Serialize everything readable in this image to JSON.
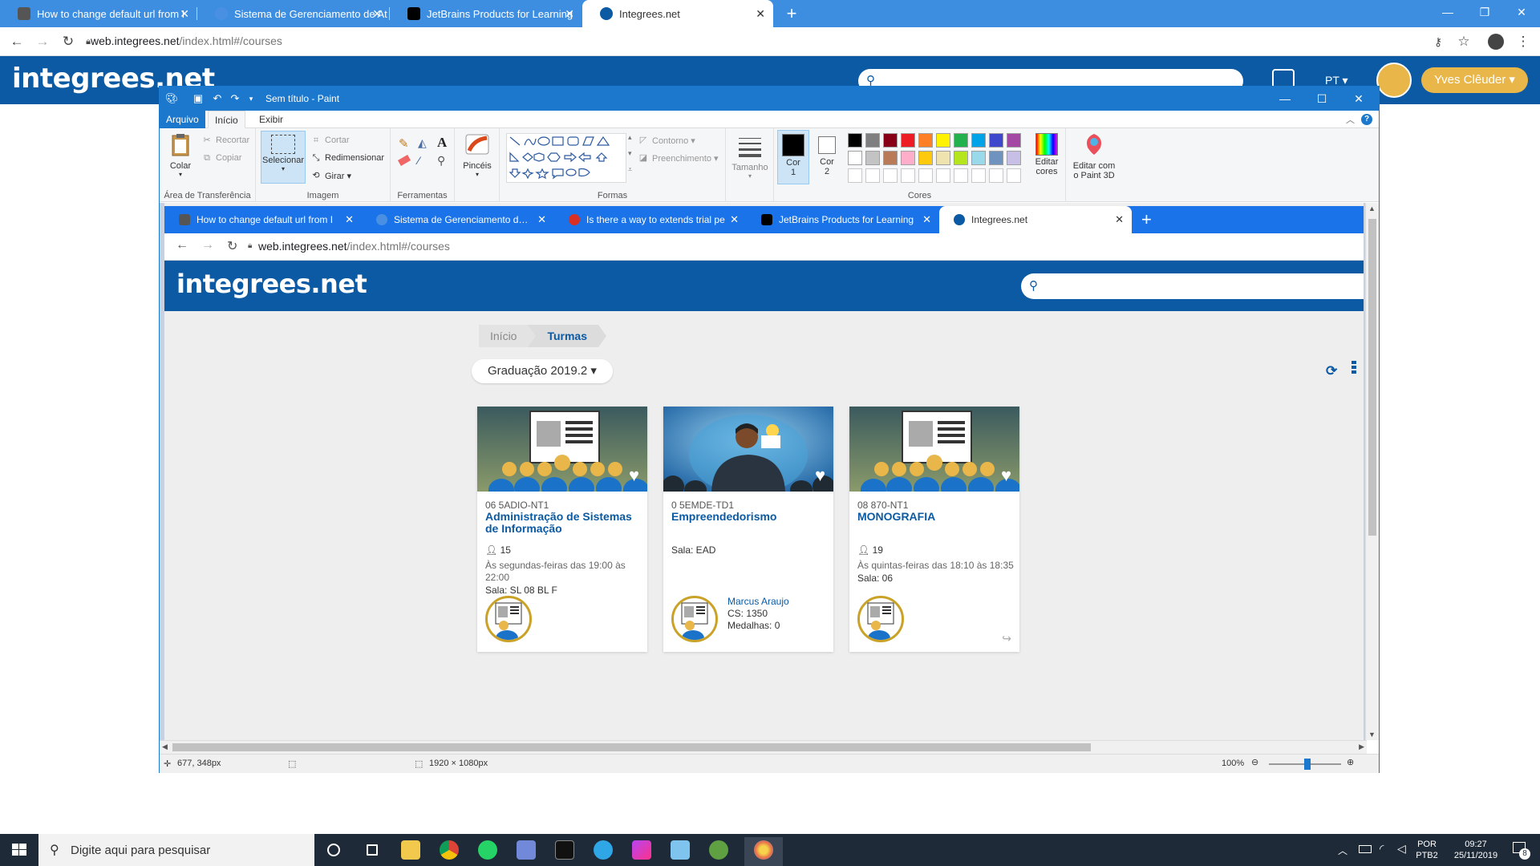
{
  "outer_browser": {
    "tabs": [
      {
        "label": "How to change default url from I",
        "favicon_color": "#555555"
      },
      {
        "label": "Sistema de Gerenciamento de At",
        "favicon_color": "#4a90e2"
      },
      {
        "label": "JetBrains Products for Learning",
        "favicon_color": "#000000"
      },
      {
        "label": "Integrees.net",
        "favicon_color": "#0b5aa3"
      }
    ],
    "url_host": "web.integrees.net",
    "url_path": "/index.html#/courses"
  },
  "outer_site": {
    "brand": "integrees.net",
    "lang": "PT ▾",
    "user_button": "Yves Clêuder ▾"
  },
  "paint": {
    "title": "Sem título - Paint",
    "ribbon_tabs": [
      "Arquivo",
      "Início",
      "Exibir"
    ],
    "clipboard": {
      "paste": "Colar",
      "cut": "Recortar",
      "copy": "Copiar",
      "group": "Área de Transferência"
    },
    "image": {
      "select": "Selecionar",
      "crop": "Cortar",
      "resize": "Redimensionar",
      "rotate": "Girar ▾",
      "group": "Imagem"
    },
    "tools": {
      "group": "Ferramentas",
      "text_tool": "A"
    },
    "brushes": "Pincéis",
    "shapes": {
      "outline": "Contorno ▾",
      "fill": "Preenchimento ▾",
      "group": "Formas"
    },
    "size": "Tamanho",
    "color1_a": "Cor",
    "color1_b": "1",
    "color2_a": "Cor",
    "color2_b": "2",
    "colors_group": "Cores",
    "edit_colors_a": "Editar",
    "edit_colors_b": "cores",
    "paint3d_a": "Editar com",
    "paint3d_b": "o Paint 3D",
    "palette_row1": [
      "#000000",
      "#7f7f7f",
      "#880015",
      "#ed1c24",
      "#ff7f27",
      "#fff200",
      "#22b14c",
      "#00a2e8",
      "#3f48cc",
      "#a349a4"
    ],
    "palette_row2": [
      "#ffffff",
      "#c3c3c3",
      "#b97a57",
      "#ffaec9",
      "#ffc90e",
      "#efe4b0",
      "#b5e61d",
      "#99d9ea",
      "#7092be",
      "#c8bfe7"
    ],
    "status": {
      "cursor": "677, 348px",
      "size": "1920 × 1080px",
      "zoom": "100%"
    }
  },
  "inner_browser": {
    "tabs": [
      {
        "label": "How to change default url from I",
        "favicon_color": "#555555"
      },
      {
        "label": "Sistema de Gerenciamento de At",
        "favicon_color": "#4a90e2"
      },
      {
        "label": "Is there a way to extends trial pe",
        "favicon_color": "#d93025"
      },
      {
        "label": "JetBrains Products for Learning",
        "favicon_color": "#000000"
      },
      {
        "label": "Integrees.net",
        "favicon_color": "#0b5aa3"
      }
    ],
    "url_host": "web.integrees.net",
    "url_path": "/index.html#/courses",
    "brand": "integrees.net"
  },
  "page": {
    "breadcrumb": [
      "Início",
      "Turmas"
    ],
    "semester": "Graduação 2019.2 ▾",
    "cards": [
      {
        "code": "06 5ADIO-NT1",
        "title": "Administração de Sistemas de Informação",
        "students": "15",
        "schedule": "Às segundas-feiras das 19:00 às 22:00",
        "room": "Sala: SL 08 BL F",
        "teacher_name": "",
        "teacher_cs": "",
        "teacher_medals": ""
      },
      {
        "code": "0 5EMDE-TD1",
        "title": "Empreendedorismo",
        "students": "",
        "schedule": "",
        "room": "Sala: EAD",
        "teacher_name": "Marcus Araujo",
        "teacher_cs": "CS: 1350",
        "teacher_medals": "Medalhas: 0"
      },
      {
        "code": "08 870-NT1",
        "title": "MONOGRAFIA",
        "students": "19",
        "schedule": "Às quintas-feiras das 18:10 às 18:35",
        "room": "Sala: 06",
        "teacher_name": "",
        "teacher_cs": "",
        "teacher_medals": ""
      }
    ]
  },
  "taskbar": {
    "search_placeholder": "Digite aqui para pesquisar",
    "lang_a": "POR",
    "lang_b": "PTB2",
    "time": "09:27",
    "date": "25/11/2019",
    "notifications": "8"
  }
}
